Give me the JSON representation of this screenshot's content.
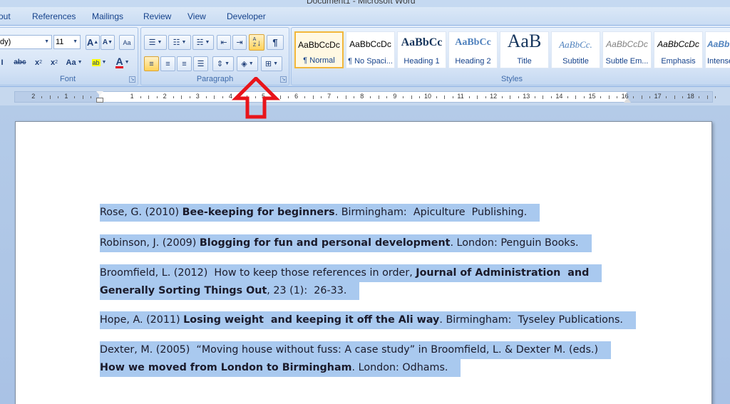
{
  "window": {
    "title": "Document1 - Microsoft Word"
  },
  "tabs": [
    "out",
    "References",
    "Mailings",
    "Review",
    "View",
    "Developer"
  ],
  "font_group": {
    "label": "Font",
    "font_name": "dy)",
    "font_size": "11",
    "grow_font": "A",
    "shrink_font": "A",
    "clear_format": "Aa",
    "strikethrough": "abc",
    "subscript": "x",
    "superscript": "x",
    "change_case": "Aa",
    "highlight": "ab",
    "font_color": "A"
  },
  "paragraph_group": {
    "label": "Paragraph",
    "sort_label": "A Z",
    "show_marks": "¶"
  },
  "styles_group": {
    "label": "Styles",
    "styles": [
      {
        "preview": "AaBbCcDc",
        "name": "¶ Normal"
      },
      {
        "preview": "AaBbCcDc",
        "name": "¶ No Spaci..."
      },
      {
        "preview": "AaBbCc",
        "name": "Heading 1"
      },
      {
        "preview": "AaBbCc",
        "name": "Heading 2"
      },
      {
        "preview": "AaB",
        "name": "Title"
      },
      {
        "preview": "AaBbCc.",
        "name": "Subtitle"
      },
      {
        "preview": "AaBbCcDc",
        "name": "Subtle Em..."
      },
      {
        "preview": "AaBbCcDc",
        "name": "Emphasis"
      },
      {
        "preview": "AaBb",
        "name": "Intense"
      }
    ]
  },
  "ruler": {
    "numbers": [
      "2",
      "1",
      "1",
      "2",
      "3",
      "4",
      "5",
      "6",
      "7",
      "8",
      "9",
      "10",
      "11",
      "12",
      "13",
      "14",
      "15",
      "16",
      "17",
      "18"
    ]
  },
  "document": {
    "paragraphs": [
      {
        "lines": [
          [
            {
              "t": "Rose, G. (2010) ",
              "b": false
            },
            {
              "t": "Bee-keeping for beginners",
              "b": true
            },
            {
              "t": ". Birmingham:  Apiculture  Publishing.",
              "b": false
            }
          ]
        ]
      },
      {
        "lines": [
          [
            {
              "t": "Robinson, J. (2009) ",
              "b": false
            },
            {
              "t": "Blogging for fun and personal development",
              "b": true
            },
            {
              "t": ". London: Penguin Books.",
              "b": false
            }
          ]
        ]
      },
      {
        "lines": [
          [
            {
              "t": "Broomfield, L. (2012)  How to keep those references in order, ",
              "b": false
            },
            {
              "t": "Journal of Administration  and",
              "b": true
            }
          ],
          [
            {
              "t": "Generally Sorting Things Out",
              "b": true
            },
            {
              "t": ", 23 (1):  26-33.",
              "b": false
            }
          ]
        ]
      },
      {
        "lines": [
          [
            {
              "t": "Hope, A. (2011) ",
              "b": false
            },
            {
              "t": "Losing weight  and keeping it off the Ali way",
              "b": true
            },
            {
              "t": ". Birmingham:  Tyseley Publications.",
              "b": false
            }
          ]
        ]
      },
      {
        "lines": [
          [
            {
              "t": "Dexter, M. (2005)  “Moving house without fuss: A case study” in Broomfield, L. & Dexter M. (eds.)",
              "b": false
            }
          ],
          [
            {
              "t": "How we moved from London to Birmingham",
              "b": true
            },
            {
              "t": ". London: Odhams.",
              "b": false
            }
          ]
        ]
      }
    ]
  },
  "colors": {
    "selection": "#a9c9ef",
    "annotation_arrow": "#e8141a",
    "ribbon_text": "#15428b"
  }
}
